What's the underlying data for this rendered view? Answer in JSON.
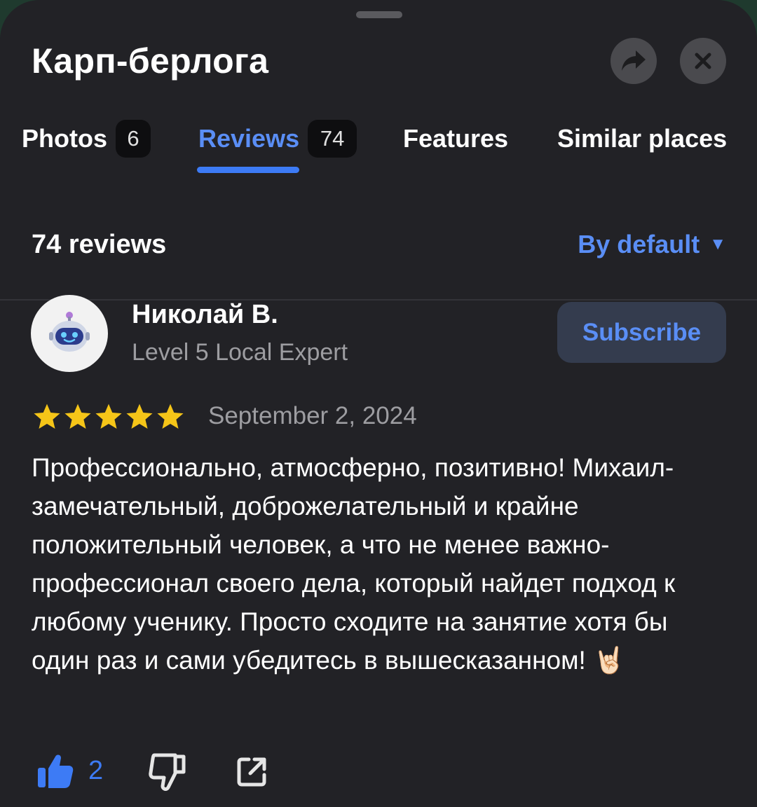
{
  "header": {
    "title": "Карп-берлога"
  },
  "tabs": [
    {
      "label": "Photos",
      "count": "6"
    },
    {
      "label": "Reviews",
      "count": "74",
      "active": true
    },
    {
      "label": "Features"
    },
    {
      "label": "Similar places"
    }
  ],
  "reviews_header": {
    "count_label": "74 reviews",
    "sort_label": "By default"
  },
  "review": {
    "author": "Николай В.",
    "level": "Level 5 Local Expert",
    "subscribe_label": "Subscribe",
    "rating": 5,
    "date": "September 2, 2024",
    "text": "Профессионально, атмосферно, позитивно! Михаил- замечательный, доброжелательный и крайне положительный человек, а что не менее важно-профессионал своего дела, который найдет подход к любому ученику. Просто сходите на занятие хотя бы один раз и сами убедитесь в вышесказанном! 🤘🏻",
    "likes": "2"
  },
  "icons": {
    "share": "share-arrow-icon",
    "close": "close-icon",
    "sort": "triangle-down-icon",
    "avatar": "robot-avatar-icon",
    "star": "star-icon",
    "like": "thumbs-up-icon",
    "dislike": "thumbs-down-icon",
    "external": "external-link-icon"
  },
  "colors": {
    "background": "#222226",
    "accent": "#3d7bf5",
    "star": "#f5c518",
    "secondary_text": "#9d9da1",
    "subscribe_bg": "#343c4e"
  }
}
